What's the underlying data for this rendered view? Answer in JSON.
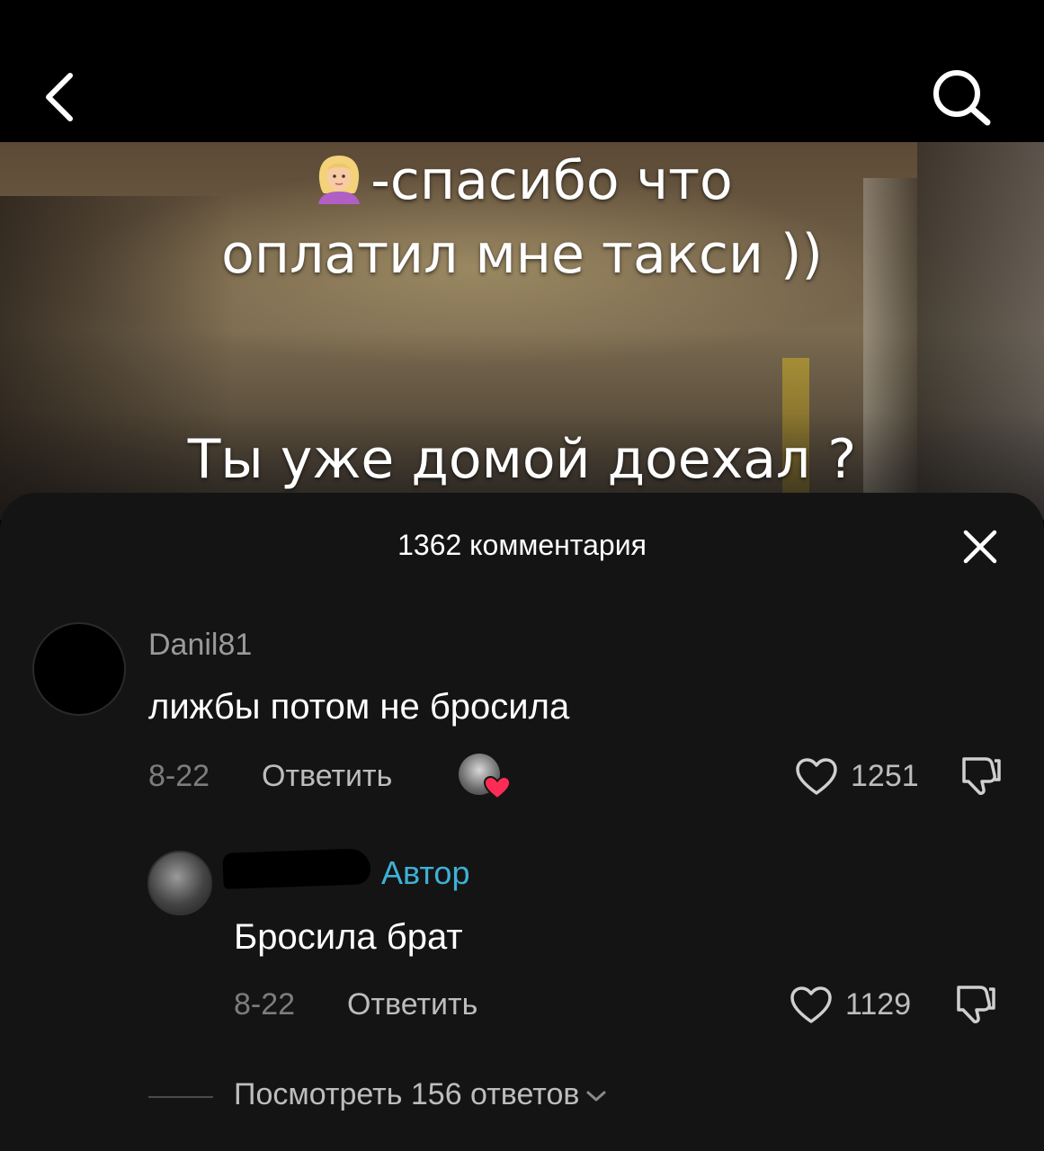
{
  "video": {
    "caption_line1": "-спасибо что",
    "caption_line2": "оплатил мне такси ))",
    "caption_line3": "Ты уже домой доехал ?"
  },
  "comments_panel": {
    "title": "1362 комментария"
  },
  "comments": [
    {
      "username": "Danil81",
      "text": "лижбы потом не бросила",
      "date": "8-22",
      "reply_label": "Ответить",
      "likes": "1251"
    }
  ],
  "replies": [
    {
      "badge": "Автор",
      "text": "Бросила брат",
      "date": "8-22",
      "reply_label": "Ответить",
      "likes": "1129"
    }
  ],
  "view_replies": "Посмотреть 156 ответов",
  "icons": {
    "back": "chevron-left-icon",
    "search": "search-icon",
    "close": "close-icon",
    "like": "heart-outline-icon",
    "dislike": "thumbs-down-icon"
  },
  "colors": {
    "author_accent": "#3fb0d6",
    "liked_heart": "#fe2c55"
  }
}
